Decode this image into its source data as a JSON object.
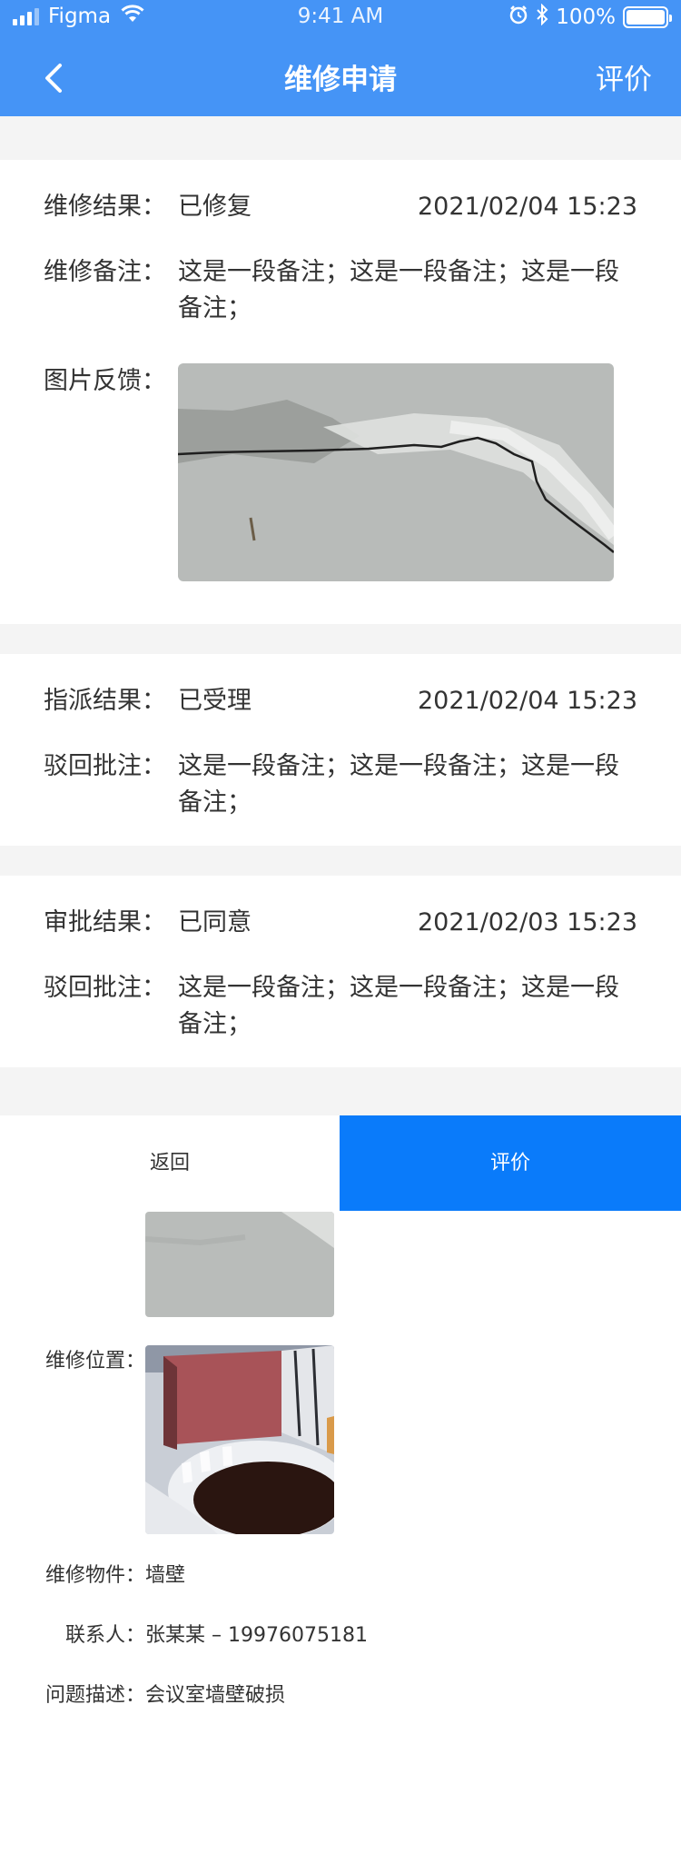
{
  "status_bar": {
    "carrier": "Figma",
    "time": "9:41 AM",
    "battery": "100%"
  },
  "nav": {
    "title": "维修申请",
    "action": "评价"
  },
  "repair_card": {
    "result_label": "维修结果：",
    "result_value": "已修复",
    "result_time": "2021/02/04 15:23",
    "note_label": "维修备注：",
    "note_value": "这是一段备注；这是一段备注；这是一段备注；",
    "photo_label": "图片反馈："
  },
  "assign_card": {
    "result_label": "指派结果：",
    "result_value": "已受理",
    "result_time": "2021/02/04 15:23",
    "note_label": "驳回批注：",
    "note_value": "这是一段备注；这是一段备注；这是一段备注；"
  },
  "approve_card": {
    "result_label": "审批结果：",
    "result_value": "已同意",
    "result_time": "2021/02/03 15:23",
    "note_label": "驳回批注：",
    "note_value": "这是一段备注；这是一段备注；这是一段备注；"
  },
  "actions": {
    "back": "返回",
    "rate": "评价"
  },
  "details": {
    "location_label": "维修位置：",
    "item_label": "维修物件：",
    "item_value": "墙壁",
    "contact_label": "联系人：",
    "contact_value": "张某某 – 19976075181",
    "problem_label": "问题描述：",
    "problem_value": "会议室墙壁破损"
  },
  "colors": {
    "header": "#4594f6",
    "primary_button": "#0a7bfa",
    "background": "#f4f4f4"
  }
}
